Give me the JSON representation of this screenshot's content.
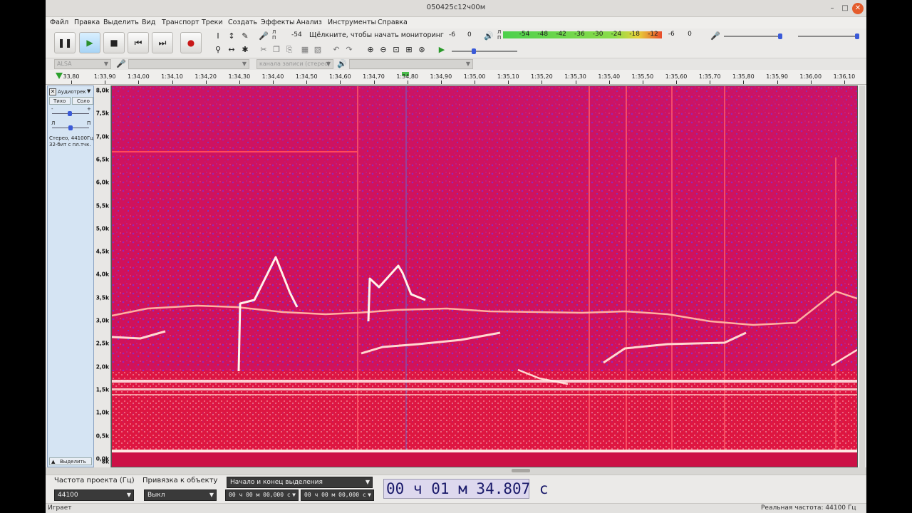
{
  "window": {
    "title": "050425с12ч00м"
  },
  "menu": [
    "Файл",
    "Правка",
    "Выделить",
    "Вид",
    "Транспорт",
    "Треки",
    "Создать",
    "Эффекты",
    "Анализ",
    "Инструменты",
    "Справка"
  ],
  "meters": {
    "record_channels": "Л\nП",
    "record_hint": "Щёлкните, чтобы начать мониторинг",
    "record_left": "-54",
    "record_right": "-6",
    "record_zero": "0",
    "play_channels": "Л\nП",
    "play_scale": [
      "-54",
      "-48",
      "-42",
      "-36",
      "-30",
      "-24",
      "-18",
      "-12",
      "-6",
      "0"
    ],
    "play_level_fraction": 0.82
  },
  "device": {
    "host": "ALSA",
    "channels": "канала записи (стерео)"
  },
  "ruler": {
    "ticks": [
      "33,80",
      "1:33,90",
      "1:34,00",
      "1:34,10",
      "1:34,20",
      "1:34,30",
      "1:34,40",
      "1:34,50",
      "1:34,60",
      "1:34,70",
      "1:34,80",
      "1:34,90",
      "1:35,00",
      "1:35,10",
      "1:35,20",
      "1:35,30",
      "1:35,40",
      "1:35,50",
      "1:35,60",
      "1:35,70",
      "1:35,80",
      "1:35,90",
      "1:36,00",
      "1:36,10"
    ]
  },
  "track": {
    "name": "Аудиотрек",
    "mute": "Тихо",
    "solo": "Соло",
    "gain_minus": "-",
    "gain_plus": "+",
    "pan_left": "Л",
    "pan_right": "П",
    "info1": "Стерео, 44100Гц",
    "info2": "32-бит с пл.тчк.",
    "select": "Выделить"
  },
  "freq_scale": [
    "8,0k",
    "7,5k",
    "7,0k",
    "6,5k",
    "6,0k",
    "5,5k",
    "5,0k",
    "4,5k",
    "4,0k",
    "3,5k",
    "3,0k",
    "2,5k",
    "2,0k",
    "1,5k",
    "1,0k",
    "0,5k",
    "0,0k",
    "8k"
  ],
  "selection": {
    "rate_label": "Частота проекта (Гц)",
    "rate_value": "44100",
    "snap_label": "Привязка к объекту",
    "snap_value": "Выкл",
    "range_mode": "Начало и конец выделения",
    "start": "00 ч 00 м 00,000 с",
    "end": "00 ч 00 м 00,000 с",
    "position": "00 ч 01 м 34.807 с"
  },
  "status": {
    "state": "Играет",
    "rate": "Реальная частота: 44100 Гц"
  }
}
